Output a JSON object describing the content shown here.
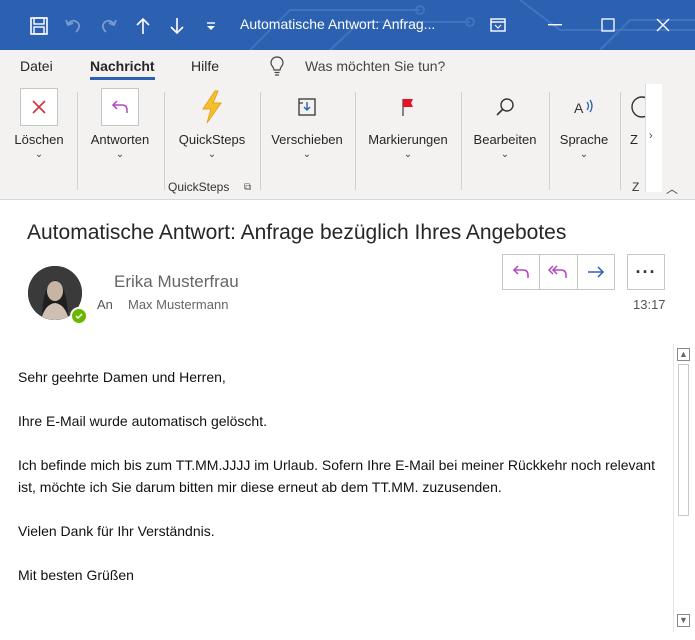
{
  "window": {
    "title": "Automatische Antwort: Anfrag...",
    "accent": "#2b61b0"
  },
  "menu": {
    "tabs": [
      {
        "label": "Datei"
      },
      {
        "label": "Nachricht"
      },
      {
        "label": "Hilfe"
      }
    ],
    "active_tab": "Nachricht",
    "tell_me": "Was möchten Sie tun?"
  },
  "ribbon": {
    "buttons": [
      {
        "label": "Löschen",
        "icon": "delete-x-icon"
      },
      {
        "label": "Antworten",
        "icon": "reply-arrow-icon"
      },
      {
        "label": "QuickSteps",
        "icon": "lightning-icon"
      },
      {
        "label": "Verschieben",
        "icon": "move-folder-icon"
      },
      {
        "label": "Markierungen",
        "icon": "flag-icon"
      },
      {
        "label": "Bearbeiten",
        "icon": "search-icon"
      },
      {
        "label": "Sprache",
        "icon": "speech-icon"
      },
      {
        "label": "Z",
        "icon": "zoom-icon"
      }
    ],
    "group_label": "QuickSteps",
    "group_label_2": "Z"
  },
  "message": {
    "subject": "Automatische Antwort: Anfrage bezüglich Ihres Angebotes",
    "sender": "Erika Musterfrau",
    "to_label": "An",
    "to_name": "Max Mustermann",
    "time": "13:17",
    "presence_color": "#6bb700",
    "actions": [
      "reply-icon",
      "reply-all-icon",
      "forward-icon",
      "more-icon"
    ],
    "more_label": "···",
    "body": [
      "Sehr geehrte Damen und Herren,",
      "Ihre E-Mail wurde automatisch gelöscht.",
      "Ich befinde mich bis zum TT.MM.JJJJ im Urlaub. Sofern Ihre E-Mail bei meiner Rückkehr noch relevant ist, möchte ich Sie darum bitten mir diese erneut ab dem TT.MM. zuzusenden.",
      "Vielen Dank für Ihr Verständnis.",
      "Mit besten Grüßen"
    ]
  }
}
